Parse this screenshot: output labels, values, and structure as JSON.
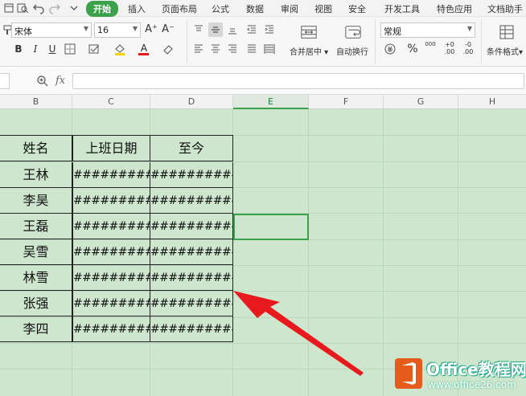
{
  "menubar": {
    "items": [
      "开始",
      "插入",
      "页面布局",
      "公式",
      "数据",
      "审阅",
      "视图",
      "安全",
      "开发工具",
      "特色应用",
      "文档助手"
    ],
    "active": "开始"
  },
  "ribbon": {
    "font_name": "宋体",
    "font_size": "16",
    "merge_label": "合并居中",
    "wrap_label": "自动换行",
    "number_format": "常规",
    "percent": "%",
    "thousands": "000",
    "dec_inc": "+0 .00",
    "dec_dec": "-0 .00",
    "cond_format_label": "条件格式",
    "bold": "B",
    "italic": "I",
    "underline": "U",
    "font_color": "A",
    "grow": "A⁺",
    "shrink": "A⁻"
  },
  "formula_bar": {
    "fx": "fx",
    "value": ""
  },
  "columns": [
    "B",
    "C",
    "D",
    "E",
    "F",
    "G",
    "H"
  ],
  "selected_column": "E",
  "table": {
    "headers": [
      "姓名",
      "上班日期",
      "至今"
    ],
    "rows": [
      [
        "王林",
        "#########",
        "##########"
      ],
      [
        "李昊",
        "#########",
        "##########"
      ],
      [
        "王磊",
        "#########",
        "##########"
      ],
      [
        "吴雪",
        "#########",
        "##########"
      ],
      [
        "林雪",
        "#########",
        "##########"
      ],
      [
        "张强",
        "#########",
        "##########"
      ],
      [
        "李四",
        "#########",
        "##########"
      ]
    ]
  },
  "watermark": {
    "brand": "Office教程网",
    "url": "www.office26.com"
  },
  "colors": {
    "accent": "#3ca14b",
    "grid_bg": "#cde6cd",
    "arrow": "#e8191c",
    "logo": "#e45b1b"
  }
}
